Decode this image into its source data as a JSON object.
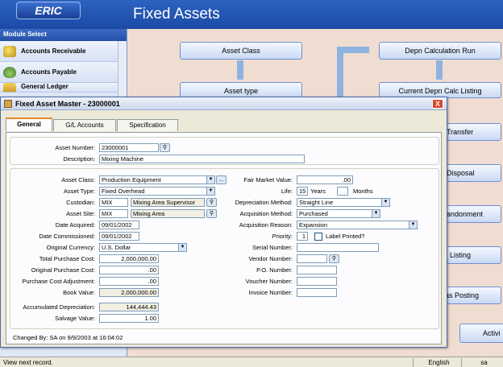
{
  "app": {
    "logo": "ERIC",
    "title": "Fixed Assets"
  },
  "sidebar": {
    "header": "Module Select",
    "items": [
      {
        "label": "Accounts Receivable",
        "icon": "coins-icon"
      },
      {
        "label": "Accounts Payable",
        "icon": "money-bag-icon"
      },
      {
        "label": "General Ledger",
        "icon": "ledger-icon"
      }
    ]
  },
  "flow": {
    "asset_class": "Asset Class",
    "asset_type": "Asset type",
    "depn_calc_run": "Depn Calculation Run",
    "current_depn_listing": "Current Depn Calc Listing",
    "transfer": "Transfer",
    "disposal": "Disposal",
    "abandonment": "andonment",
    "listing": "Listing",
    "posting": "as Posting",
    "activity": "Activi"
  },
  "dialog": {
    "title": "Fixed Asset Master - 23000001",
    "close": "X",
    "tabs": [
      "General",
      "G/L Accounts",
      "Specification"
    ],
    "fields": {
      "asset_number_label": "Asset Number:",
      "asset_number": "23000001",
      "description_label": "Description:",
      "description": "Mixing Machine",
      "asset_class_label": "Asset Class:",
      "asset_class": "Production Equipment",
      "asset_type_label": "Asset Type:",
      "asset_type": "Fixed Overhead",
      "custodian_label": "Custodian:",
      "custodian_code": "MIX",
      "custodian_name": "Mixing Area Supervisor",
      "asset_site_label": "Asset Site:",
      "asset_site_code": "MIX",
      "asset_site_name": "Mixing Area",
      "date_acquired_label": "Date Acquired:",
      "date_acquired": "09/01/2002",
      "date_commissioned_label": "Date Commissioned:",
      "date_commissioned": "09/01/2002",
      "original_currency_label": "Original Currency:",
      "original_currency": "U.S. Dollar",
      "total_purchase_cost_label": "Total Purchase Cost:",
      "total_purchase_cost": "2,000,000.00",
      "original_purchase_cost_label": "Original Purchase Cost:",
      "original_purchase_cost": ".00",
      "purchase_cost_adj_label": "Purchase Cost Adjustment:",
      "purchase_cost_adj": ".00",
      "book_value_label": "Book Value:",
      "book_value": "2,000,000.00",
      "accum_depn_label": "Accumulated  Depreciation:",
      "accum_depn": "144,444.43",
      "salvage_value_label": "Salvage Value:",
      "salvage_value": "1.00",
      "fair_market_value_label": "Fair Market Value:",
      "fair_market_value": ".00",
      "life_label": "Life:",
      "life_years": "15",
      "years_label": "Years",
      "months_label": "Months",
      "depn_method_label": "Depreciation Method:",
      "depn_method": "Straight Line",
      "acq_method_label": "Acquisition Method:",
      "acq_method": "Purchased",
      "acq_reason_label": "Acquisition Reason:",
      "acq_reason": "Expansion",
      "priority_label": "Priority:",
      "priority": "1",
      "label_printed_label": "Label Printed?",
      "serial_number_label": "Serial Number:",
      "vendor_number_label": "Vendor Number:",
      "po_number_label": "P.O. Number:",
      "voucher_number_label": "Voucher Number:",
      "invoice_number_label": "Invoice Number:"
    },
    "changed_by": "Changed By: SA on 9/9/2003 at 16:04:02"
  },
  "statusbar": {
    "message": "View next record.",
    "language": "English",
    "user": "sa"
  }
}
